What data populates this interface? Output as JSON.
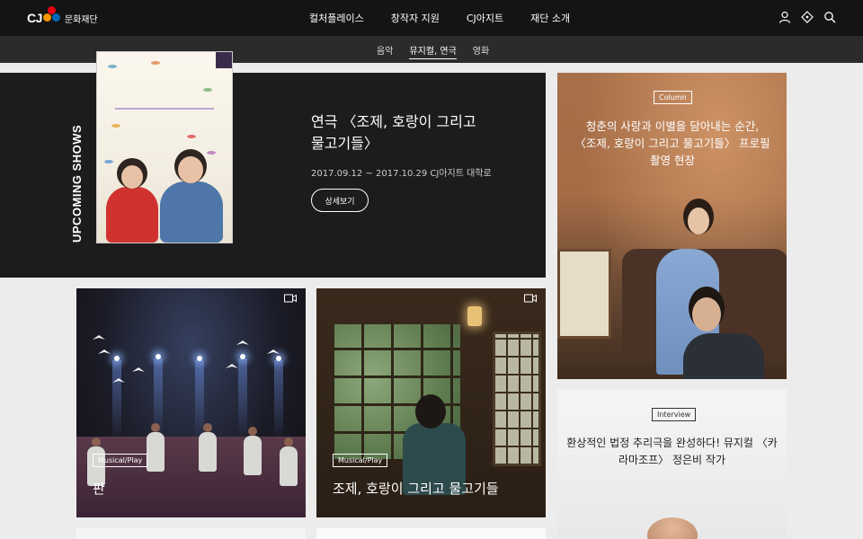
{
  "brand": {
    "logo_text": "CJ",
    "name": "문화재단"
  },
  "top_nav": [
    "컬처플레이스",
    "창작자 지원",
    "CJ아지트",
    "재단 소개"
  ],
  "top_icons": [
    "user-icon",
    "ticket-icon",
    "search-icon"
  ],
  "sub_nav": [
    {
      "label": "음악",
      "active": false
    },
    {
      "label": "뮤지컬, 연극",
      "active": true
    },
    {
      "label": "영화",
      "active": false
    }
  ],
  "upcoming": {
    "label": "UPCOMING SHOWS",
    "title": "연극 〈조제, 호랑이 그리고 물고기들〉",
    "date": "2017.09.12 ~ 2017.10.29 CJ아지트 대학로",
    "button": "상세보기",
    "poster_title": "조제, 호랑이 그리고 물고기들"
  },
  "column_card": {
    "tag": "Column",
    "title": "청춘의 사랑과 이별을 담아내는 순간, 〈조제, 호랑이 그리고 물고기들〉 프로필 촬영 현장"
  },
  "interview_card": {
    "tag": "Interview",
    "title": "환상적인 법정 추리극을 완성하다! 뮤지컬 〈카라마조프〉 정은비 작가"
  },
  "cards": [
    {
      "tag": "Musical/Play",
      "title": "판",
      "icon": "video-icon"
    },
    {
      "tag": "Musical/Play",
      "title": "조제, 호랑이 그리고 물고기들",
      "icon": "video-icon"
    }
  ]
}
